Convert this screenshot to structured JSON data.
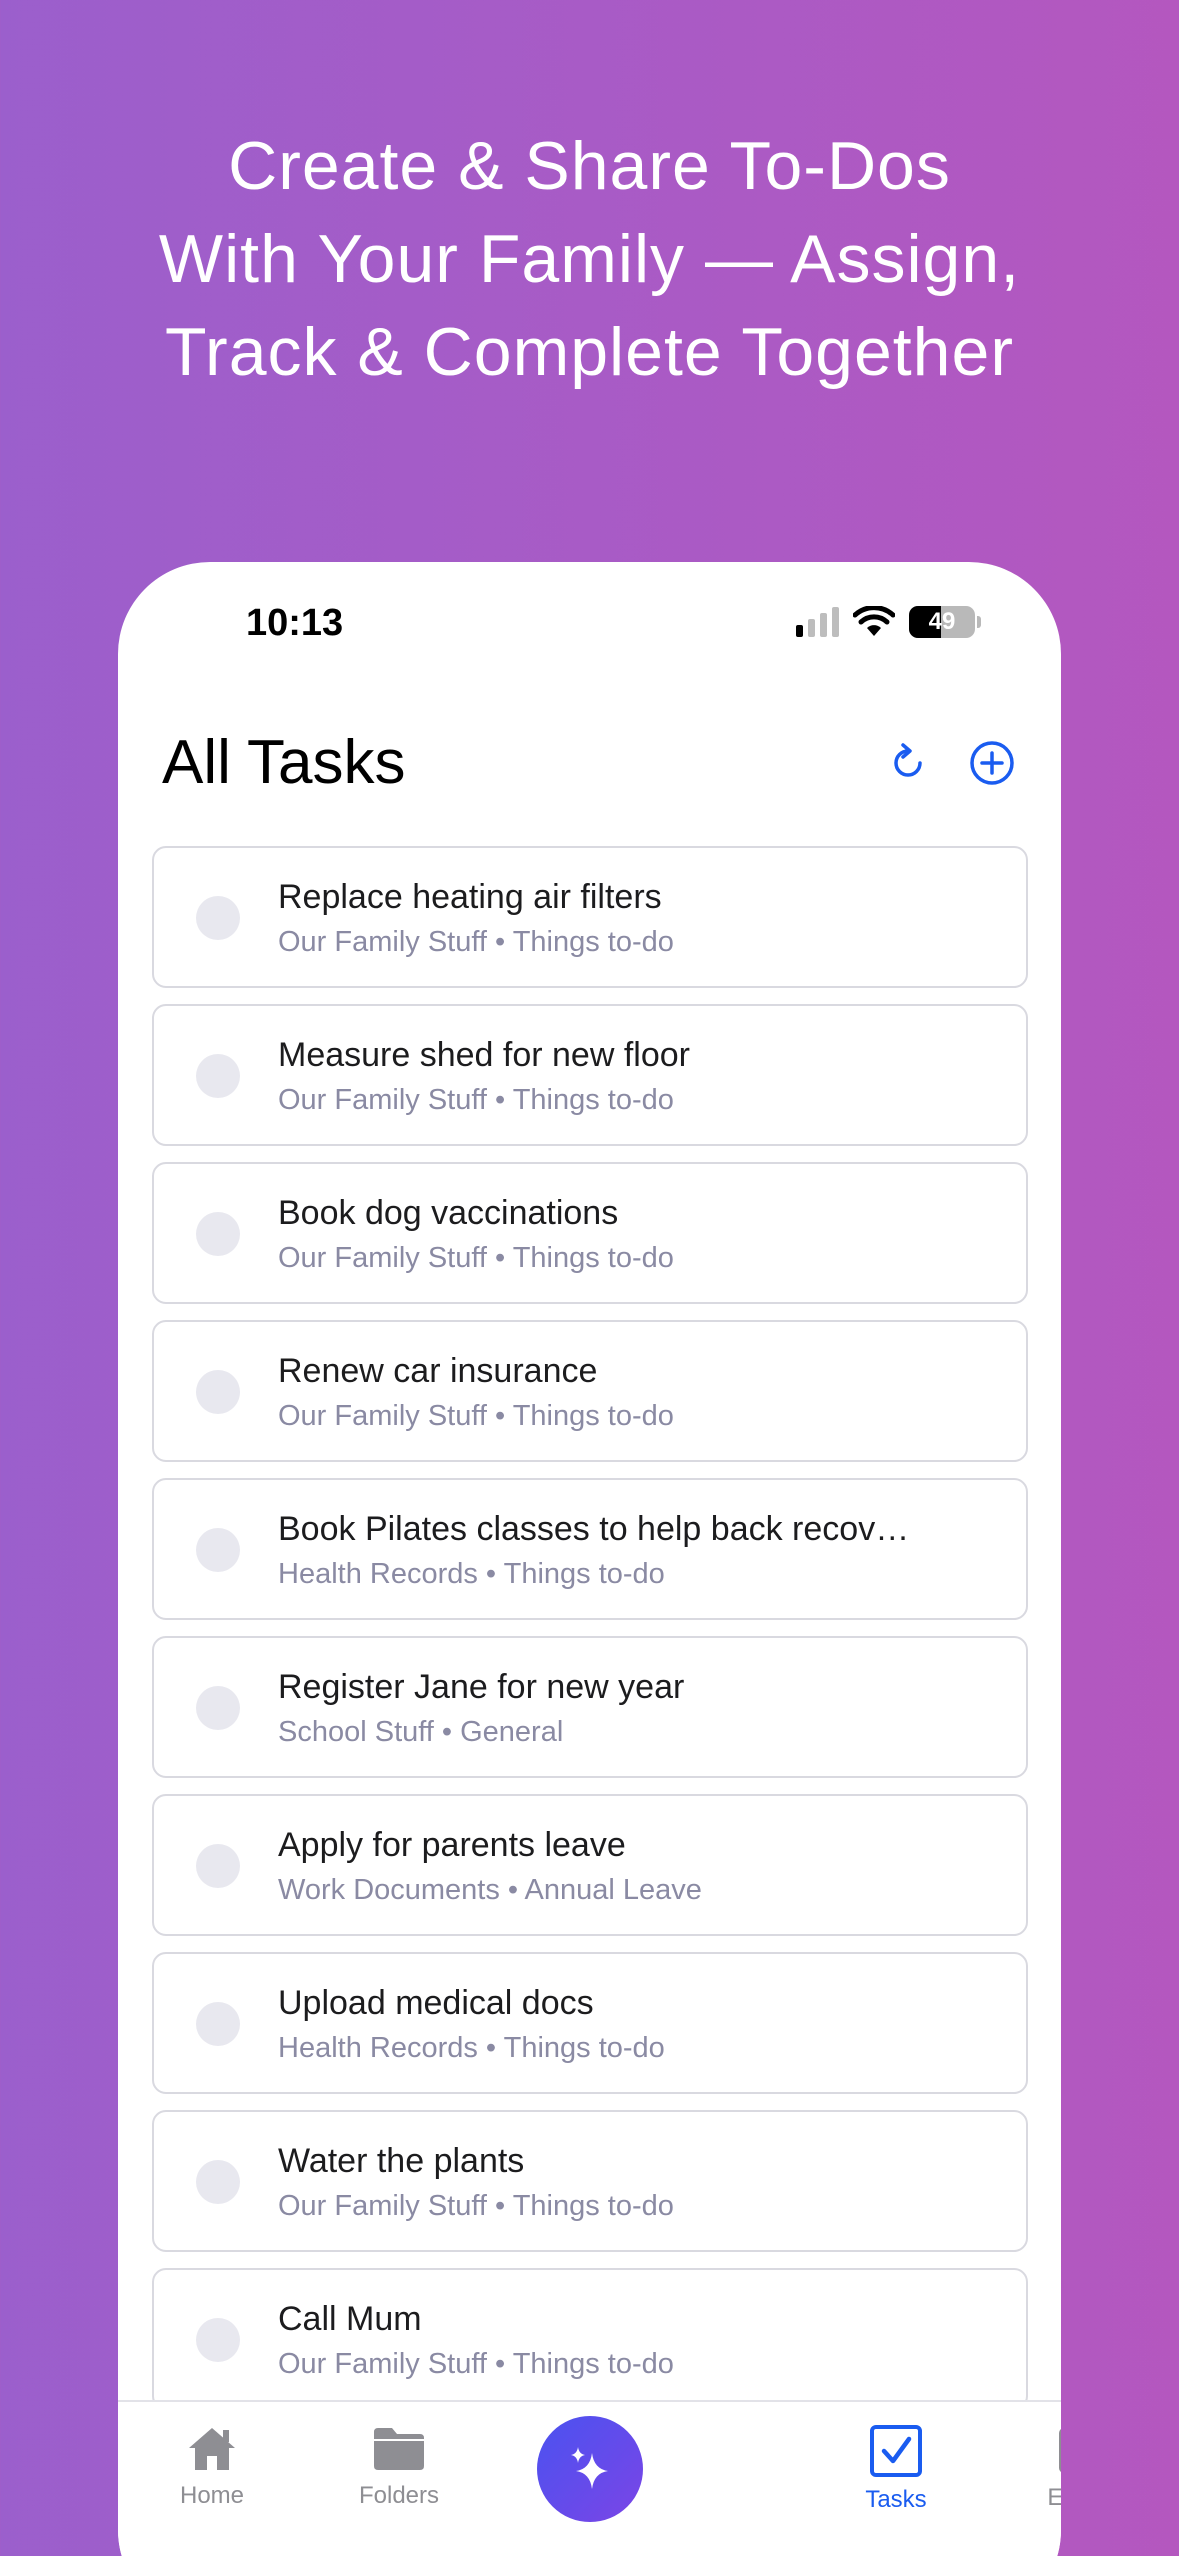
{
  "headline": {
    "line1": "Create & Share To-Dos",
    "line2": "With Your Family — Assign,",
    "line3": "Track & Complete Together"
  },
  "status_bar": {
    "time": "10:13",
    "battery_percent": "49",
    "signal_bars_active": 1,
    "signal_bars_total": 4
  },
  "header": {
    "title": "All Tasks",
    "refresh_icon": "refresh-icon",
    "add_icon": "add-circle-icon"
  },
  "tasks": [
    {
      "title": "Replace heating air filters",
      "subtitle": "Our Family Stuff • Things to-do"
    },
    {
      "title": "Measure shed for new floor",
      "subtitle": "Our Family Stuff • Things to-do"
    },
    {
      "title": "Book dog vaccinations",
      "subtitle": "Our Family Stuff • Things to-do"
    },
    {
      "title": "Renew car insurance",
      "subtitle": "Our Family Stuff • Things to-do"
    },
    {
      "title": "Book Pilates classes to help back recov…",
      "subtitle": "Health Records • Things to-do"
    },
    {
      "title": "Register Jane for new year",
      "subtitle": "School Stuff • General"
    },
    {
      "title": "Apply for parents leave",
      "subtitle": "Work Documents • Annual Leave"
    },
    {
      "title": "Upload medical docs",
      "subtitle": "Health Records • Things to-do"
    },
    {
      "title": "Water the plants",
      "subtitle": "Our Family Stuff • Things to-do"
    },
    {
      "title": "Call Mum",
      "subtitle": "Our Family Stuff • Things to-do"
    }
  ],
  "tab_bar": {
    "home": "Home",
    "folders": "Folders",
    "tasks": "Tasks",
    "events": "Events",
    "active": "tasks"
  },
  "colors": {
    "accent": "#1a5cf0",
    "fab_start": "#4a52f0",
    "fab_end": "#7b45e6",
    "subtitle": "#8a8aa3"
  }
}
